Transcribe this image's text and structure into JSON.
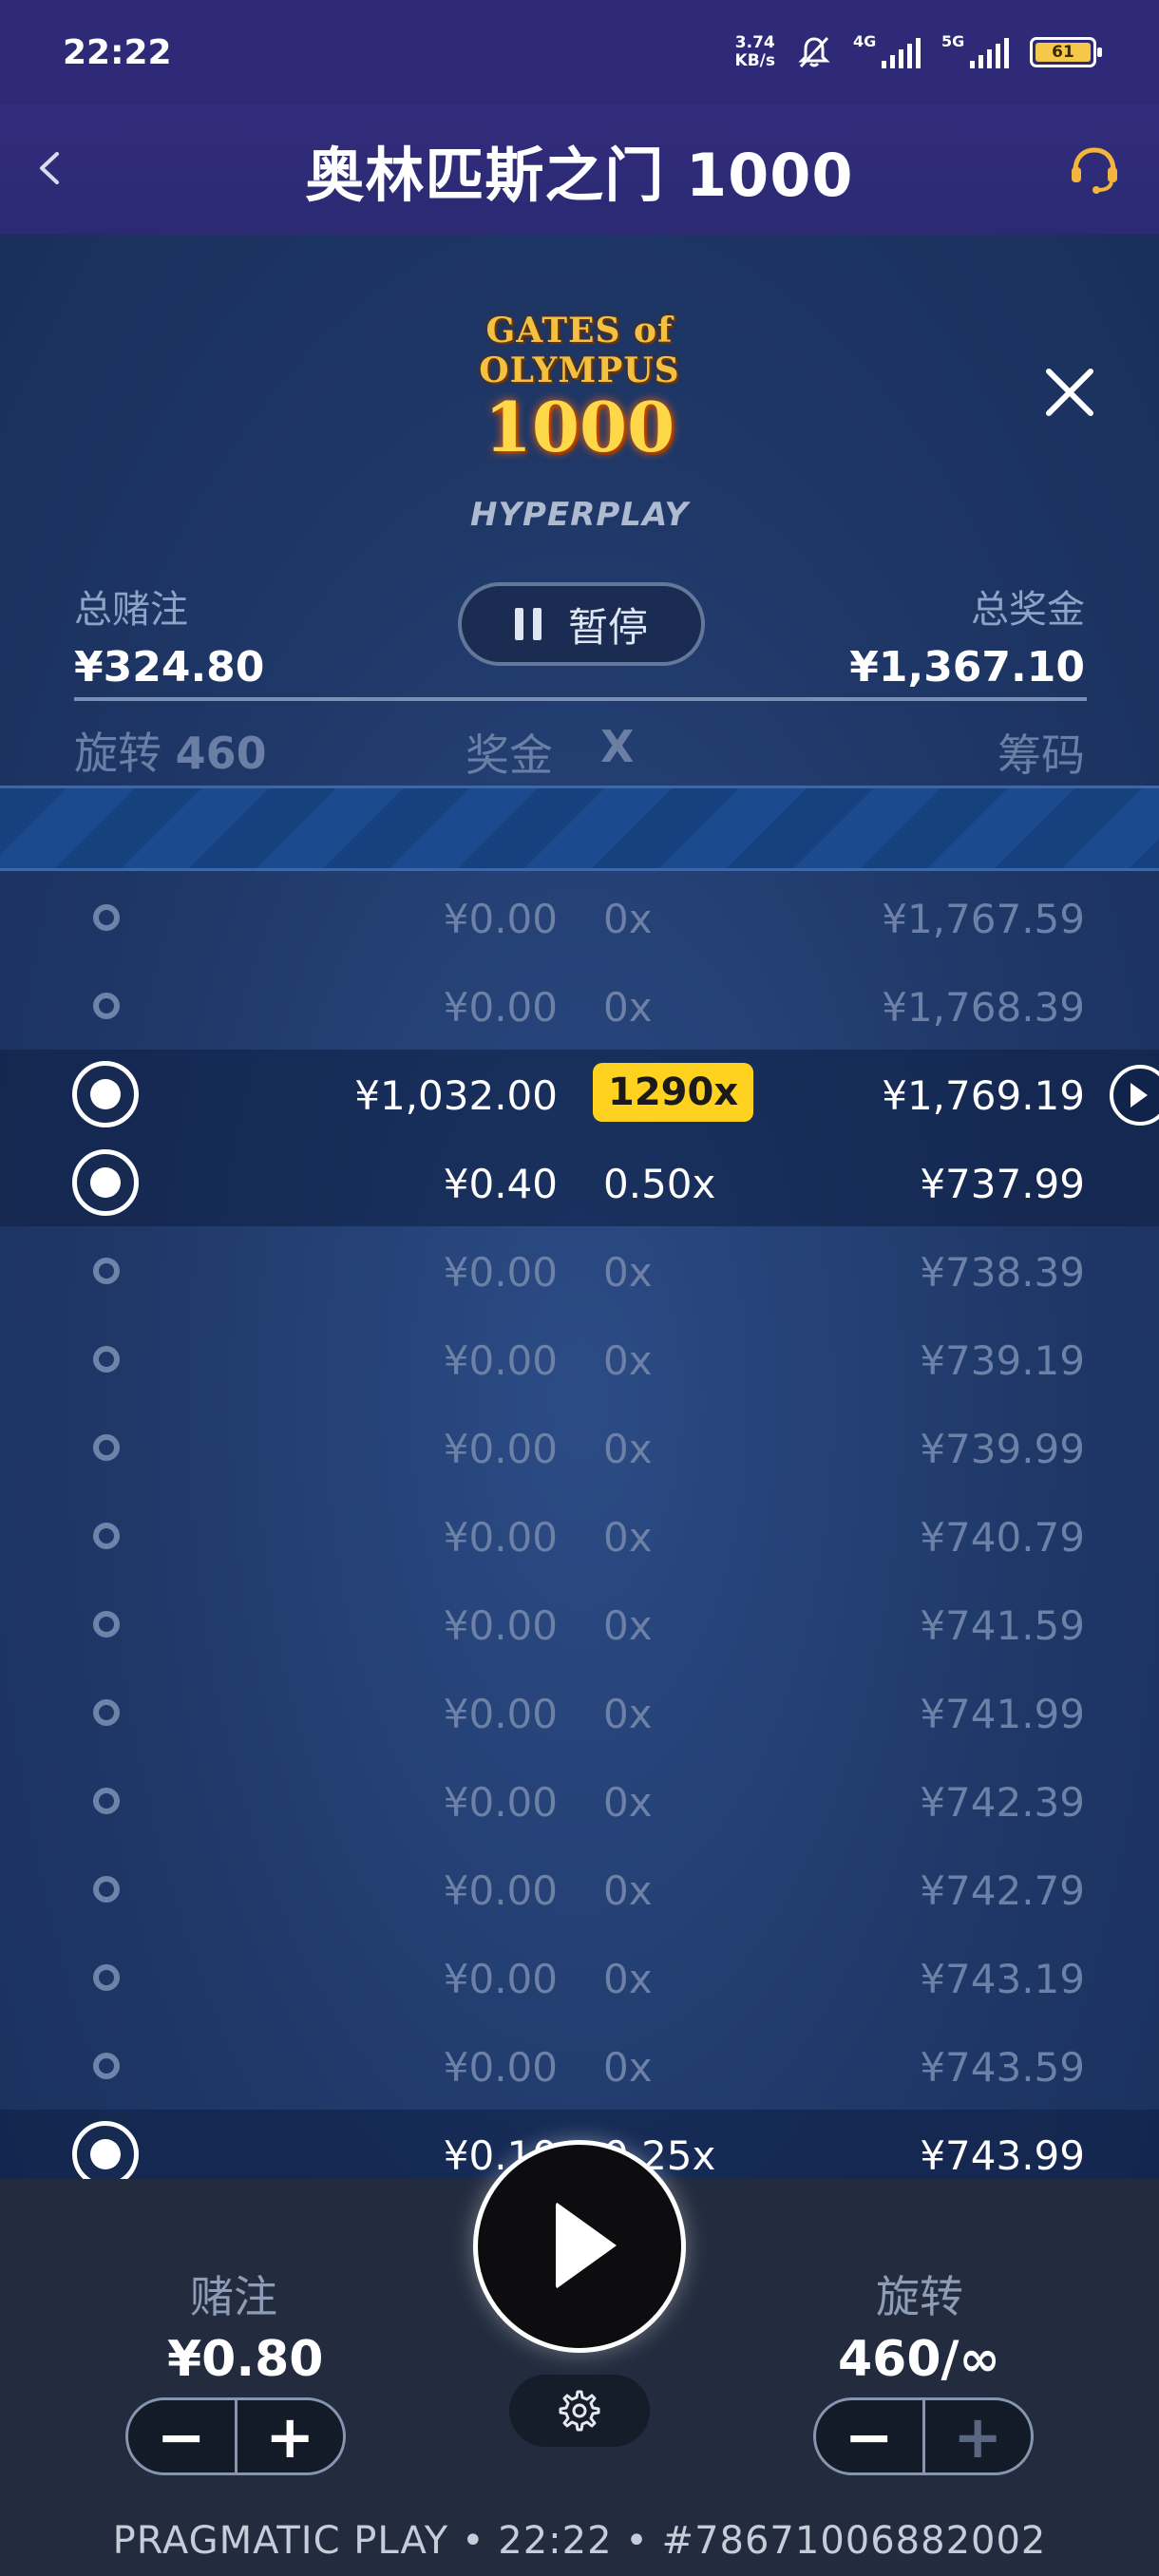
{
  "status_bar": {
    "time": "22:22",
    "net_speed_value": "3.74",
    "net_speed_unit": "KB/s",
    "signal_1_label": "4G",
    "signal_2_label": "5G",
    "battery": "61"
  },
  "header": {
    "title": "奥林匹斯之门 1000"
  },
  "game": {
    "logo_line1": "GATES of OLYMPUS",
    "logo_line2": "1000",
    "mode_label": "HYPERPLAY",
    "total_bet_label": "总赌注",
    "total_bet_value": "¥324.80",
    "pause_label": "暂停",
    "total_win_label": "总奖金",
    "total_win_value": "¥1,367.10",
    "columns": {
      "spins_label": "旋转",
      "spins_value": "460",
      "prize": "奖金",
      "mult": "X",
      "chips": "筹码"
    },
    "rows": [
      {
        "prize": "¥0.00",
        "mult": "0x",
        "chips": "¥1,767.59",
        "state": "dim"
      },
      {
        "prize": "¥0.00",
        "mult": "0x",
        "chips": "¥1,768.39",
        "state": "dim"
      },
      {
        "prize": "¥1,032.00",
        "mult": "1290x",
        "chips": "¥1,769.19",
        "state": "big-win"
      },
      {
        "prize": "¥0.40",
        "mult": "0.50x",
        "chips": "¥737.99",
        "state": "win"
      },
      {
        "prize": "¥0.00",
        "mult": "0x",
        "chips": "¥738.39",
        "state": "dim"
      },
      {
        "prize": "¥0.00",
        "mult": "0x",
        "chips": "¥739.19",
        "state": "dim"
      },
      {
        "prize": "¥0.00",
        "mult": "0x",
        "chips": "¥739.99",
        "state": "dim"
      },
      {
        "prize": "¥0.00",
        "mult": "0x",
        "chips": "¥740.79",
        "state": "dim"
      },
      {
        "prize": "¥0.00",
        "mult": "0x",
        "chips": "¥741.59",
        "state": "dim"
      },
      {
        "prize": "¥0.00",
        "mult": "0x",
        "chips": "¥741.99",
        "state": "dim"
      },
      {
        "prize": "¥0.00",
        "mult": "0x",
        "chips": "¥742.39",
        "state": "dim"
      },
      {
        "prize": "¥0.00",
        "mult": "0x",
        "chips": "¥742.79",
        "state": "dim"
      },
      {
        "prize": "¥0.00",
        "mult": "0x",
        "chips": "¥743.19",
        "state": "dim"
      },
      {
        "prize": "¥0.00",
        "mult": "0x",
        "chips": "¥743.59",
        "state": "dim"
      },
      {
        "prize": "¥0.10",
        "mult": "0.25x",
        "chips": "¥743.99",
        "state": "win"
      }
    ]
  },
  "controls": {
    "bet_label": "赌注",
    "bet_value": "¥0.80",
    "spins_label": "旋转",
    "spins_value": "460/∞",
    "minus": "−",
    "plus": "+"
  },
  "footer": {
    "text": "PRAGMATIC PLAY • 22:22 • #78671006882002"
  },
  "colors": {
    "header_bg": "#2f2a78",
    "panel_bg": "#1e3260",
    "badge": "#ffd21f",
    "bottom_bg": "#222c3e"
  }
}
